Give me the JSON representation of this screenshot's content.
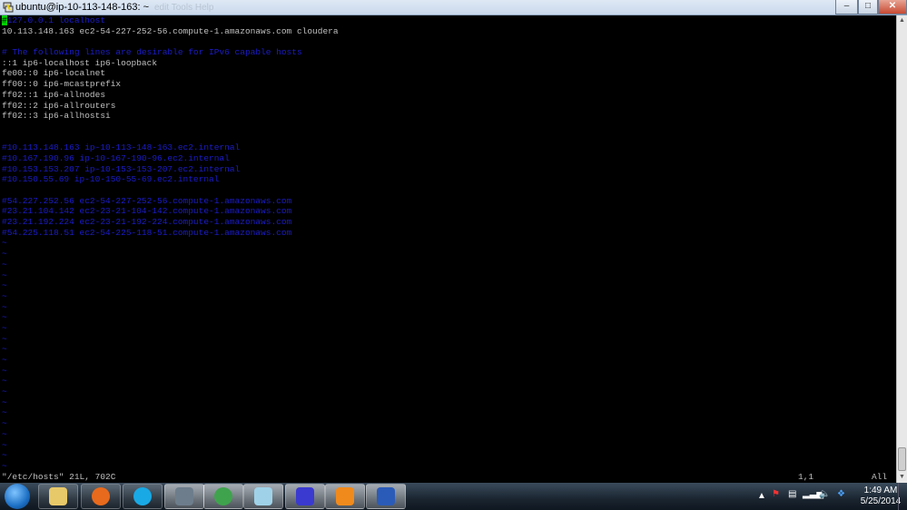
{
  "window": {
    "title": "ubuntu@ip-10-113-148-163: ~",
    "ghost_menu": "edit   Tools   Help",
    "min": "–",
    "max": "□",
    "close": "✕"
  },
  "terminal": {
    "lines": [
      {
        "text": "127.0.0.1 localhost",
        "cursor_char": "#",
        "comment": true
      },
      {
        "text": "10.113.148.163 ec2-54-227-252-56.compute-1.amazonaws.com cloudera",
        "comment": false
      },
      {
        "text": "",
        "comment": false
      },
      {
        "text": "# The following lines are desirable for IPv6 capable hosts",
        "comment": true
      },
      {
        "text": "::1 ip6-localhost ip6-loopback",
        "comment": false
      },
      {
        "text": "fe00::0 ip6-localnet",
        "comment": false
      },
      {
        "text": "ff00::0 ip6-mcastprefix",
        "comment": false
      },
      {
        "text": "ff02::1 ip6-allnodes",
        "comment": false
      },
      {
        "text": "ff02::2 ip6-allrouters",
        "comment": false
      },
      {
        "text": "ff02::3 ip6-allhostsi",
        "comment": false
      },
      {
        "text": "",
        "comment": false
      },
      {
        "text": "",
        "comment": false
      },
      {
        "text": "#10.113.148.163 ip-10-113-148-163.ec2.internal",
        "comment": true
      },
      {
        "text": "#10.167.190.96 ip-10-167-190-96.ec2.internal",
        "comment": true
      },
      {
        "text": "#10.153.153.207 ip-10-153-153-207.ec2.internal",
        "comment": true
      },
      {
        "text": "#10.150.55.69 ip-10-150-55-69.ec2.internal",
        "comment": true
      },
      {
        "text": "",
        "comment": false
      },
      {
        "text": "#54.227.252.56 ec2-54-227-252-56.compute-1.amazonaws.com",
        "comment": true
      },
      {
        "text": "#23.21.104.142 ec2-23-21-104-142.compute-1.amazonaws.com",
        "comment": true
      },
      {
        "text": "#23.21.192.224 ec2-23-21-192-224.compute-1.amazonaws.com",
        "comment": true
      },
      {
        "text": "#54.225.118.51 ec2-54-225-118-51.compute-1.amazonaws.com",
        "comment": true
      }
    ],
    "tilde": "~",
    "tilde_count": 22
  },
  "status": {
    "file": "\"/etc/hosts\" 21L, 702C",
    "position": "1,1",
    "scroll": "All"
  },
  "taskbar": {
    "apps": [
      "Windows Explorer",
      "Firefox",
      "Skype",
      "Terminal",
      "Chrome",
      "Notepad",
      "PuTTY",
      "Media Player",
      "Word"
    ],
    "clock_time": "1:49 AM",
    "clock_date": "5/25/2014"
  },
  "colors": {
    "comment": "#1c1ccc",
    "cursor": "#00d000",
    "text": "#c0c0c0"
  }
}
